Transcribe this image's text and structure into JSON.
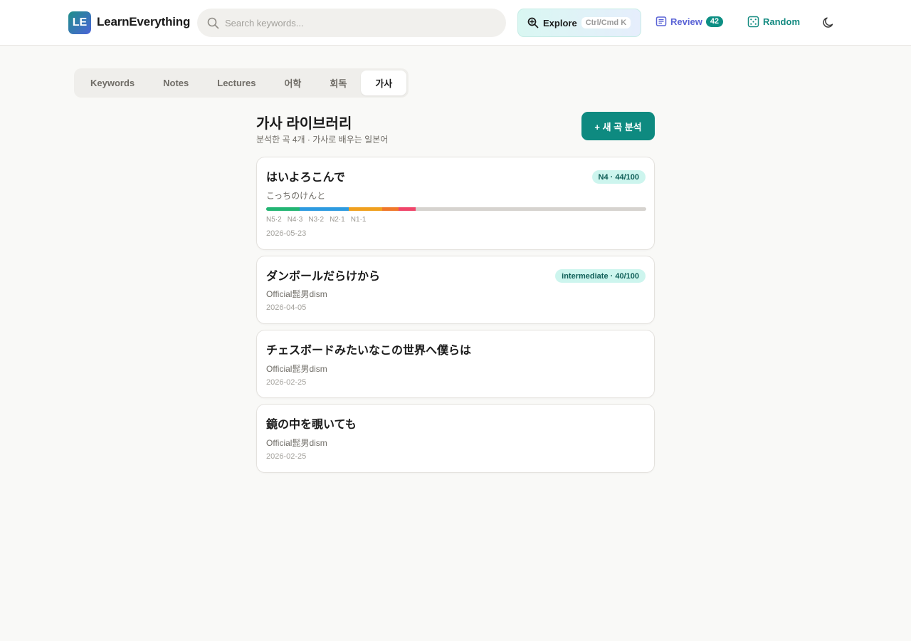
{
  "header": {
    "logo_text": "LE",
    "brand": "LearnEverything",
    "search_placeholder": "Search keywords...",
    "explore_label": "Explore",
    "explore_shortcut": "Ctrl/Cmd K",
    "review_label": "Review",
    "review_count": "42",
    "random_label": "Random"
  },
  "tabs": [
    {
      "label": "Keywords",
      "active": false
    },
    {
      "label": "Notes",
      "active": false
    },
    {
      "label": "Lectures",
      "active": false
    },
    {
      "label": "어학",
      "active": false
    },
    {
      "label": "회독",
      "active": false
    },
    {
      "label": "가사",
      "active": true
    }
  ],
  "library": {
    "title": "가사 라이브러리",
    "subtitle": "분석한 곡 4개 · 가사로 배우는 일본어",
    "new_button": "+ 새 곡 분석"
  },
  "songs": [
    {
      "title": "はいよろこんで",
      "artist": "こっちのけんと",
      "badge": "N4 · 44/100",
      "date": "2026-05-23",
      "jlpt": [
        {
          "label": "N5·2",
          "count": 2,
          "color": "#22b573"
        },
        {
          "label": "N4·3",
          "count": 3,
          "color": "#2d9be0"
        },
        {
          "label": "N3·2",
          "count": 2,
          "color": "#f0a01e"
        },
        {
          "label": "N2·1",
          "count": 1,
          "color": "#f0782a"
        },
        {
          "label": "N1·1",
          "count": 1,
          "color": "#f0456a"
        }
      ]
    },
    {
      "title": "ダンボールだらけから",
      "artist": "Official髭男dism",
      "badge": "intermediate · 40/100",
      "date": "2026-04-05"
    },
    {
      "title": "チェスボードみたいなこの世界へ僕らは",
      "artist": "Official髭男dism",
      "badge": "",
      "date": "2026-02-25"
    },
    {
      "title": "鏡の中を覗いても",
      "artist": "Official髭男dism",
      "badge": "",
      "date": "2026-02-25"
    }
  ]
}
